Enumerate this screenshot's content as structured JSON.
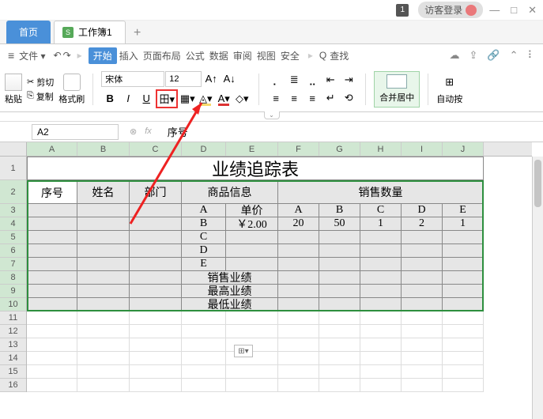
{
  "window": {
    "badge": "1",
    "guest_login": "访客登录"
  },
  "tabs": {
    "home": "首页",
    "file_name": "工作簿1",
    "add": "+"
  },
  "ribbon_head": {
    "file": "文件",
    "tabs": [
      "开始",
      "插入",
      "页面布局",
      "公式",
      "数据",
      "审阅",
      "视图",
      "安全"
    ],
    "search": "查找"
  },
  "toolbar": {
    "paste": "粘贴",
    "cut": "剪切",
    "copy": "复制",
    "fmt_paint": "格式刷",
    "font_name": "宋体",
    "font_size": "12",
    "merge": "合并居中",
    "auto": "自动按"
  },
  "cell_ref": "A2",
  "formula": "序号",
  "fx": "fx",
  "col_labels": [
    "A",
    "B",
    "C",
    "D",
    "E",
    "F",
    "G",
    "H",
    "I",
    "J"
  ],
  "row_labels": [
    "1",
    "2",
    "3",
    "4",
    "5",
    "6",
    "7",
    "8",
    "9",
    "10",
    "11",
    "12",
    "13",
    "14",
    "15",
    "16"
  ],
  "sheet": {
    "title": "业绩追踪表",
    "h_seq": "序号",
    "h_name": "姓名",
    "h_dept": "部门",
    "h_product": "商品信息",
    "h_sales_qty": "销售数量",
    "sub_a": "A",
    "sub_price": "单价",
    "sub_b": "B",
    "sub_c": "C",
    "sub_d": "D",
    "sub_e": "E",
    "r4_d": "B",
    "r4_e": "￥2.00",
    "r4_f": "20",
    "r4_g": "50",
    "r4_h": "1",
    "r4_i": "2",
    "r4_j": "1",
    "r5_d": "C",
    "r6_d": "D",
    "r7_d": "E",
    "r8": "销售业绩",
    "r9": "最高业绩",
    "r10": "最低业绩",
    "paste_opt": "⊞▾"
  }
}
